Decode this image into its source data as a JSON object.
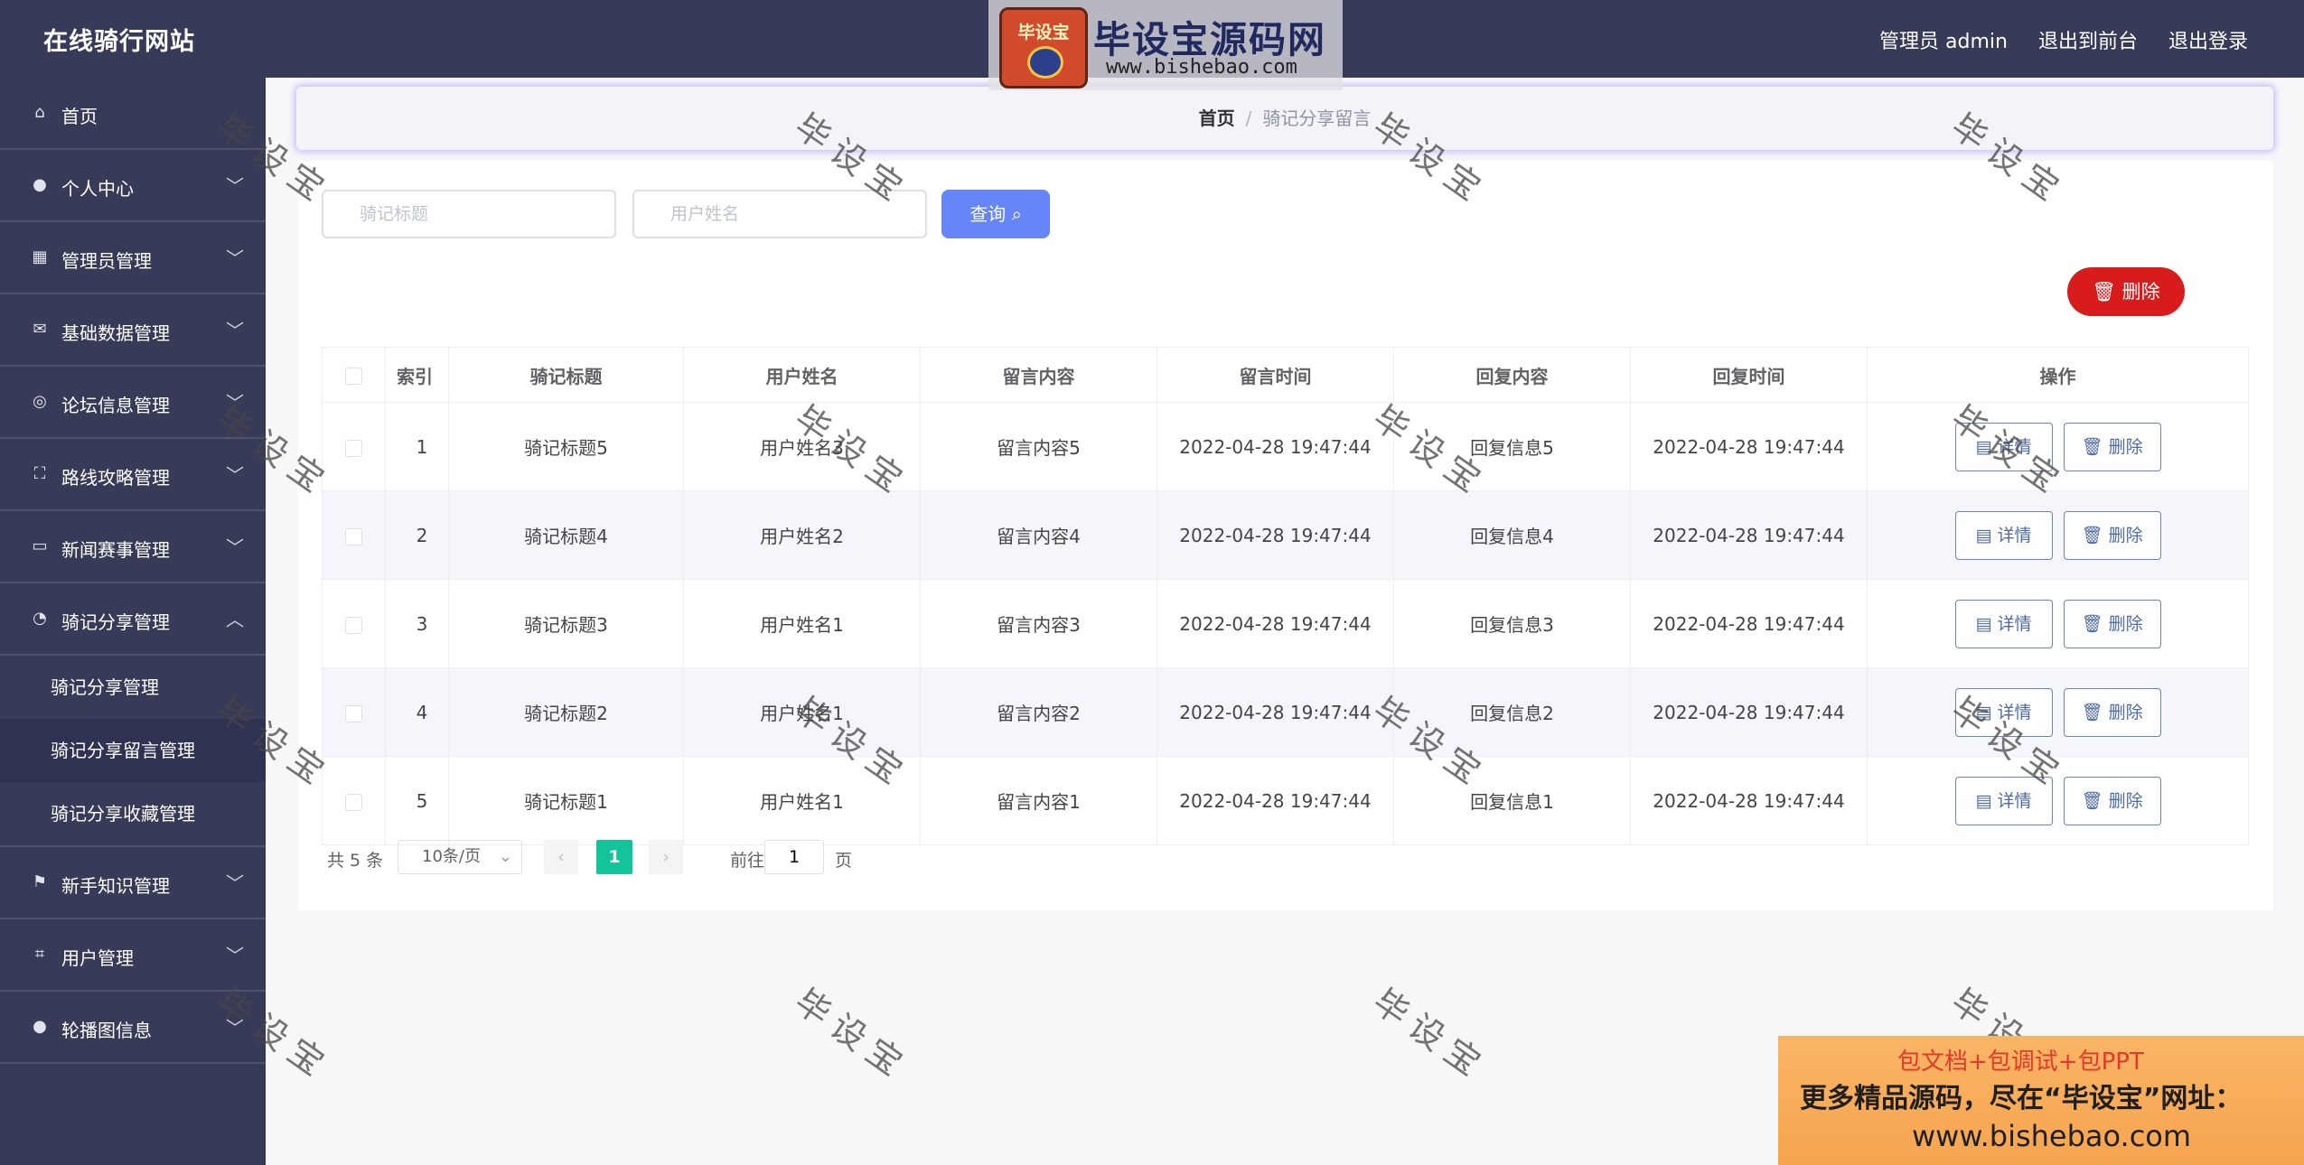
{
  "header": {
    "site_title": "在线骑行网站",
    "admin_label": "管理员 admin",
    "back_front": "退出到前台",
    "logout": "退出登录"
  },
  "watermark_logo": {
    "badge": "毕设宝",
    "title": "毕设宝源码网",
    "url": "www.bishebao.com"
  },
  "sidebar": {
    "items": [
      {
        "icon": "home-icon",
        "glyph": "⌂",
        "label": "首页"
      },
      {
        "icon": "user-icon",
        "glyph": "●",
        "label": "个人中心",
        "arrow": "﹀"
      },
      {
        "icon": "grid-icon",
        "glyph": "▦",
        "label": "管理员管理",
        "arrow": "﹀"
      },
      {
        "icon": "mail-icon",
        "glyph": "✉",
        "label": "基础数据管理",
        "arrow": "﹀"
      },
      {
        "icon": "compass-icon",
        "glyph": "◎",
        "label": "论坛信息管理",
        "arrow": "﹀"
      },
      {
        "icon": "fullscreen-icon",
        "glyph": "⛶",
        "label": "路线攻略管理",
        "arrow": "﹀"
      },
      {
        "icon": "chat-icon",
        "glyph": "▭",
        "label": "新闻赛事管理",
        "arrow": "﹀"
      },
      {
        "icon": "gauge-icon",
        "glyph": "◔",
        "label": "骑记分享管理",
        "arrow": "︿"
      },
      {
        "icon": "flag-icon",
        "glyph": "⚑",
        "label": "新手知识管理",
        "arrow": "﹀"
      },
      {
        "icon": "crop-icon",
        "glyph": "⌗",
        "label": "用户管理",
        "arrow": "﹀"
      },
      {
        "icon": "user-icon",
        "glyph": "●",
        "label": "轮播图信息",
        "arrow": "﹀"
      }
    ],
    "submenu": [
      "骑记分享管理",
      "骑记分享留言管理",
      "骑记分享收藏管理"
    ]
  },
  "breadcrumb": {
    "home": "首页",
    "separator": "/",
    "current": "骑记分享留言"
  },
  "search": {
    "title_placeholder": "骑记标题",
    "user_placeholder": "用户姓名",
    "query_label": "查询 ⌕"
  },
  "actions": {
    "delete_label": "删除"
  },
  "table": {
    "headers": [
      "",
      "索引",
      "骑记标题",
      "用户姓名",
      "留言内容",
      "留言时间",
      "回复内容",
      "回复时间",
      "操作"
    ],
    "rows": [
      [
        "",
        "1",
        "骑记标题5",
        "用户姓名3",
        "留言内容5",
        "2022-04-28 19:47:44",
        "回复信息5",
        "2022-04-28 19:47:44"
      ],
      [
        "",
        "2",
        "骑记标题4",
        "用户姓名2",
        "留言内容4",
        "2022-04-28 19:47:44",
        "回复信息4",
        "2022-04-28 19:47:44"
      ],
      [
        "",
        "3",
        "骑记标题3",
        "用户姓名1",
        "留言内容3",
        "2022-04-28 19:47:44",
        "回复信息3",
        "2022-04-28 19:47:44"
      ],
      [
        "",
        "4",
        "骑记标题2",
        "用户姓名1",
        "留言内容2",
        "2022-04-28 19:47:44",
        "回复信息2",
        "2022-04-28 19:47:44"
      ],
      [
        "",
        "5",
        "骑记标题1",
        "用户姓名1",
        "留言内容1",
        "2022-04-28 19:47:44",
        "回复信息1",
        "2022-04-28 19:47:44"
      ]
    ],
    "detail_label": "详情",
    "delete_label": "删除"
  },
  "pagination": {
    "total": "共 5 条",
    "page_size": "10条/页",
    "current_page": "1",
    "goto_label": "前往",
    "goto_value": "1",
    "page_unit": "页",
    "prev": "‹",
    "next": "›"
  },
  "watermark_text": "毕设宝",
  "ad_banner": {
    "line1": "包文档+包调试+包PPT",
    "line2": "更多精品源码，尽在“毕设宝”网址：",
    "line3": "www.bishebao.com"
  },
  "colors": {
    "sidebar_bg": "#383b57",
    "primary_button": "#6685f7",
    "danger_button": "#d81b1b",
    "page_active": "#13c39a"
  }
}
